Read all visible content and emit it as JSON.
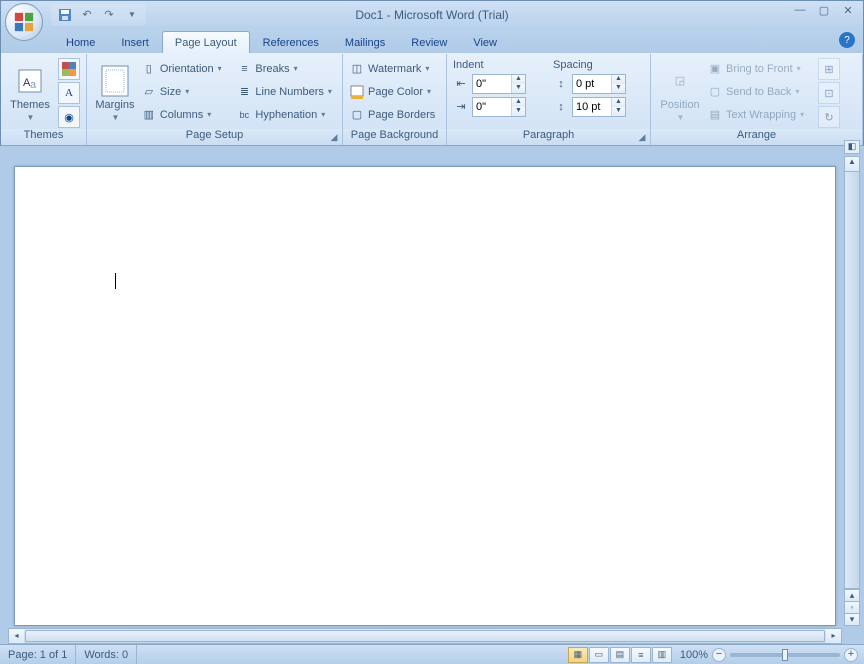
{
  "title": "Doc1 - Microsoft Word (Trial)",
  "tabs": [
    "Home",
    "Insert",
    "Page Layout",
    "References",
    "Mailings",
    "Review",
    "View"
  ],
  "active_tab": 2,
  "groups": {
    "themes": {
      "label": "Themes",
      "button": "Themes"
    },
    "page_setup": {
      "label": "Page Setup",
      "margins": "Margins",
      "orientation": "Orientation",
      "size": "Size",
      "columns": "Columns",
      "breaks": "Breaks",
      "line_numbers": "Line Numbers",
      "hyphenation": "Hyphenation"
    },
    "page_background": {
      "label": "Page Background",
      "watermark": "Watermark",
      "page_color": "Page Color",
      "page_borders": "Page Borders"
    },
    "paragraph": {
      "label": "Paragraph",
      "indent": "Indent",
      "spacing": "Spacing",
      "indent_left": "0\"",
      "indent_right": "0\"",
      "space_before": "0 pt",
      "space_after": "10 pt"
    },
    "arrange": {
      "label": "Arrange",
      "position": "Position",
      "bring_front": "Bring to Front",
      "send_back": "Send to Back",
      "text_wrap": "Text Wrapping"
    }
  },
  "status": {
    "page": "Page: 1 of 1",
    "words": "Words: 0",
    "zoom": "100%"
  }
}
